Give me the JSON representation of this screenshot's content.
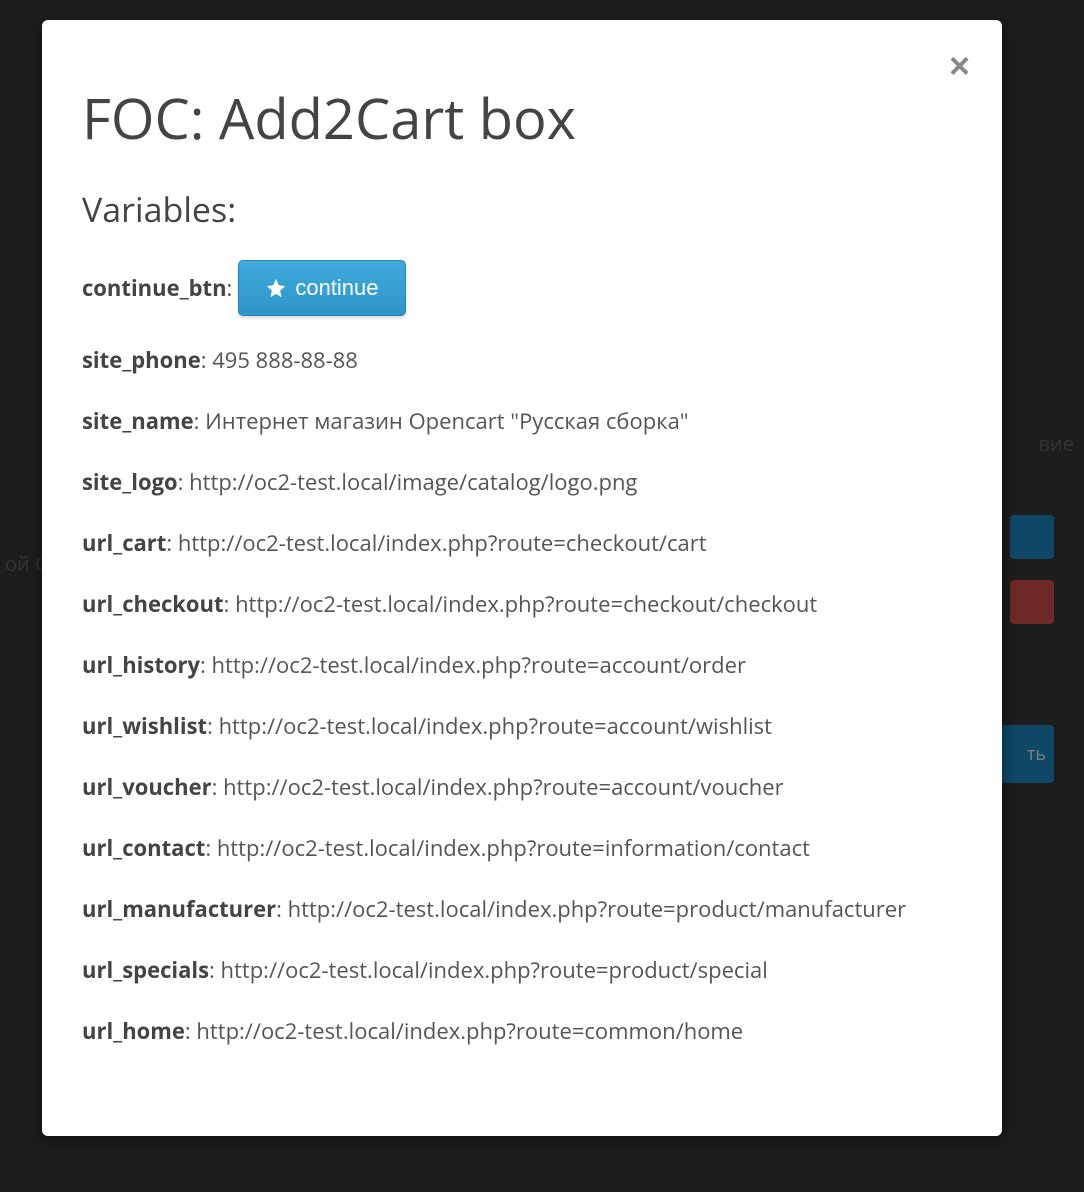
{
  "backdrop": {
    "text_right": "вие",
    "text_left": "ой С",
    "btn3_label": "ть"
  },
  "modal": {
    "title": "FOC: Add2Cart box",
    "subtitle": "Variables:",
    "continue_btn_key": "continue_btn",
    "continue_btn_label": "continue",
    "vars": [
      {
        "key": "site_phone",
        "value": "495 888-88-88"
      },
      {
        "key": "site_name",
        "value": "Интернет магазин Opencart \"Русская сборка\""
      },
      {
        "key": "site_logo",
        "value": "http://oc2-test.local/image/catalog/logo.png"
      },
      {
        "key": "url_cart",
        "value": "http://oc2-test.local/index.php?route=checkout/cart"
      },
      {
        "key": "url_checkout",
        "value": "http://oc2-test.local/index.php?route=checkout/checkout"
      },
      {
        "key": "url_history",
        "value": "http://oc2-test.local/index.php?route=account/order"
      },
      {
        "key": "url_wishlist",
        "value": "http://oc2-test.local/index.php?route=account/wishlist"
      },
      {
        "key": "url_voucher",
        "value": "http://oc2-test.local/index.php?route=account/voucher"
      },
      {
        "key": "url_contact",
        "value": "http://oc2-test.local/index.php?route=information/contact"
      },
      {
        "key": "url_manufacturer",
        "value": "http://oc2-test.local/index.php?route=product/manufacturer"
      },
      {
        "key": "url_specials",
        "value": "http://oc2-test.local/index.php?route=product/special"
      },
      {
        "key": "url_home",
        "value": "http://oc2-test.local/index.php?route=common/home"
      }
    ]
  }
}
